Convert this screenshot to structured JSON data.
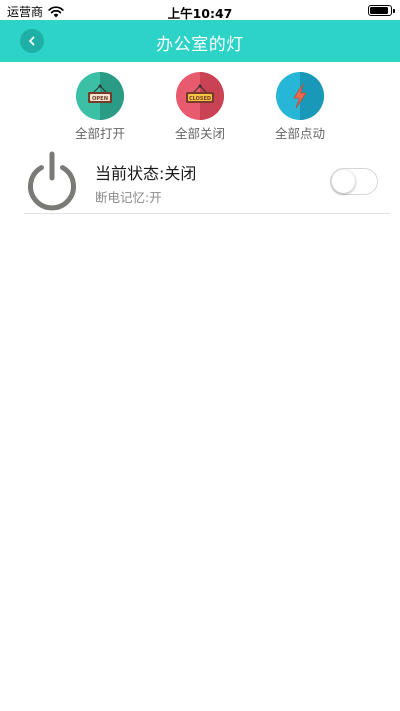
{
  "status_bar": {
    "carrier": "运营商",
    "time": "上午10:47",
    "battery_level": 0.9
  },
  "nav": {
    "title": "办公室的灯",
    "back_icon": "chevron-left-icon"
  },
  "actions": [
    {
      "label": "全部打开",
      "sign_text": "OPEN",
      "icon": "open-sign-icon",
      "color_light": "#3bbfa5",
      "color_dark": "#2a9c86"
    },
    {
      "label": "全部关闭",
      "sign_text": "CLOSED",
      "icon": "closed-sign-icon",
      "color_light": "#e85b6e",
      "color_dark": "#c94355"
    },
    {
      "label": "全部点动",
      "icon": "lightning-icon",
      "color_light": "#28b6d6",
      "color_dark": "#1a98b8"
    }
  ],
  "device": {
    "icon": "power-icon",
    "state": "当前状态:关闭",
    "memory": "断电记忆:开",
    "switch_on": false
  },
  "colors": {
    "accent": "#2ed3c8",
    "power_icon": "#7a7a76"
  }
}
